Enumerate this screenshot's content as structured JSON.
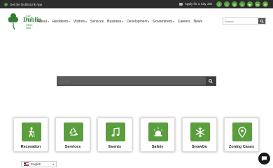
{
  "topbar": {
    "app_label": "Get the DublinLink App",
    "apply_label": "Apply for a City Job",
    "socials": [
      {
        "icon": "facebook-icon",
        "glyph": "f"
      },
      {
        "icon": "twitter-icon",
        "glyph": "t"
      },
      {
        "icon": "instagram-icon",
        "glyph": "◎"
      },
      {
        "icon": "flickr-icon",
        "glyph": "••"
      },
      {
        "icon": "youtube-icon",
        "glyph": "▶"
      },
      {
        "icon": "linkedin-icon",
        "glyph": "in"
      },
      {
        "icon": "mail-icon",
        "glyph": "✉"
      }
    ]
  },
  "logo": {
    "city": "City of",
    "name": "Dublin",
    "state": "OHIO, USA"
  },
  "nav": {
    "items": [
      {
        "label": "About",
        "has_menu": true
      },
      {
        "label": "Residents",
        "has_menu": true
      },
      {
        "label": "Visitors",
        "has_menu": true
      },
      {
        "label": "Services",
        "has_menu": false
      },
      {
        "label": "Business",
        "has_menu": true
      },
      {
        "label": "Development",
        "has_menu": true
      },
      {
        "label": "Government",
        "has_menu": true
      },
      {
        "label": "Careers",
        "has_menu": false
      },
      {
        "label": "News",
        "has_menu": false
      }
    ],
    "search_placeholder": "Search"
  },
  "hero": {
    "search_placeholder": "Search"
  },
  "tiles": [
    {
      "label": "Recreation",
      "icon": "hiker-icon"
    },
    {
      "label": "Services",
      "icon": "recycle-icon"
    },
    {
      "label": "Events",
      "icon": "music-note-icon"
    },
    {
      "label": "Safety",
      "icon": "siren-icon"
    },
    {
      "label": "SnowGo",
      "icon": "snowflake-icon"
    },
    {
      "label": "Zoning Cases",
      "icon": "map-pin-icon"
    }
  ],
  "language": {
    "selected": "English"
  },
  "colors": {
    "brand_green": "#5a9e3e",
    "topbar": "#2c2c2c"
  }
}
